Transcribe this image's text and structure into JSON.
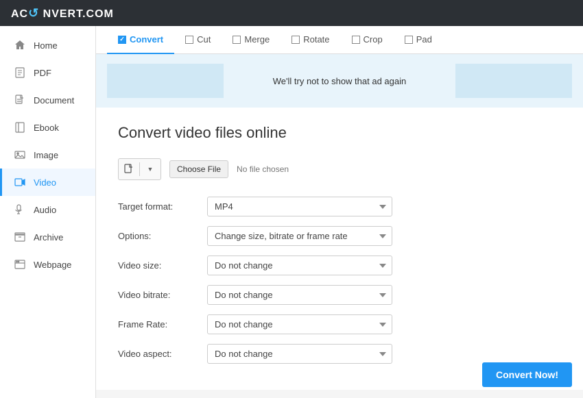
{
  "header": {
    "logo": "AC",
    "logo_icon": "↺",
    "logo_rest": "NVERT.COM"
  },
  "sidebar": {
    "items": [
      {
        "id": "home",
        "label": "Home",
        "icon": "home",
        "active": false
      },
      {
        "id": "pdf",
        "label": "PDF",
        "icon": "pdf",
        "active": false
      },
      {
        "id": "document",
        "label": "Document",
        "icon": "document",
        "active": false
      },
      {
        "id": "ebook",
        "label": "Ebook",
        "icon": "ebook",
        "active": false
      },
      {
        "id": "image",
        "label": "Image",
        "icon": "image",
        "active": false
      },
      {
        "id": "video",
        "label": "Video",
        "icon": "video",
        "active": true
      },
      {
        "id": "audio",
        "label": "Audio",
        "icon": "audio",
        "active": false
      },
      {
        "id": "archive",
        "label": "Archive",
        "icon": "archive",
        "active": false
      },
      {
        "id": "webpage",
        "label": "Webpage",
        "icon": "webpage",
        "active": false
      }
    ]
  },
  "tabs": [
    {
      "id": "convert",
      "label": "Convert",
      "checked": true,
      "active": true
    },
    {
      "id": "cut",
      "label": "Cut",
      "checked": false,
      "active": false
    },
    {
      "id": "merge",
      "label": "Merge",
      "checked": false,
      "active": false
    },
    {
      "id": "rotate",
      "label": "Rotate",
      "checked": false,
      "active": false
    },
    {
      "id": "crop",
      "label": "Crop",
      "checked": false,
      "active": false
    },
    {
      "id": "pad",
      "label": "Pad",
      "checked": false,
      "active": false
    }
  ],
  "ad_banner": {
    "text": "We'll try not to show that ad again"
  },
  "main": {
    "title": "Convert video files online",
    "file_chooser": {
      "button_label": "Choose File",
      "no_file_text": "No file chosen"
    },
    "form": {
      "target_format_label": "Target format:",
      "target_format_value": "MP4",
      "options_label": "Options:",
      "options_value": "Change size, bitrate or frame rate",
      "video_size_label": "Video size:",
      "video_size_value": "Do not change",
      "video_bitrate_label": "Video bitrate:",
      "video_bitrate_value": "Do not change",
      "frame_rate_label": "Frame Rate:",
      "frame_rate_value": "Do not change",
      "video_aspect_label": "Video aspect:",
      "video_aspect_value": "Do not change"
    },
    "convert_btn_label": "Convert Now!"
  }
}
